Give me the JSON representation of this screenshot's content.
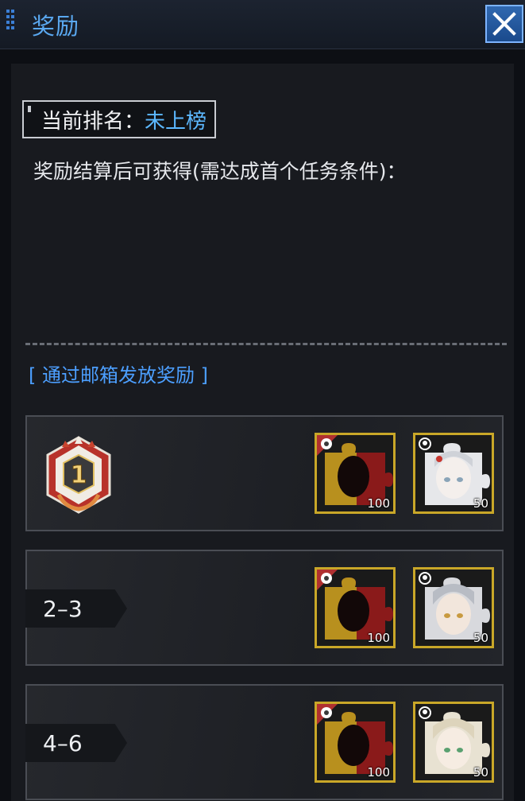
{
  "header": {
    "title": "奖励"
  },
  "rank": {
    "label": "当前排名：",
    "value": "未上榜"
  },
  "note": "奖励结算后可获得(需达成首个任务条件)：",
  "mail_note": "[ 通过邮箱发放奖励 ]",
  "rows": [
    {
      "rank_label": "1",
      "items": [
        {
          "icon": "puzzle-red-gold-icon",
          "quantity": "100"
        },
        {
          "icon": "puzzle-character-white-hair-icon",
          "quantity": "50"
        }
      ]
    },
    {
      "rank_label": "2–3",
      "items": [
        {
          "icon": "puzzle-red-gold-icon",
          "quantity": "100"
        },
        {
          "icon": "puzzle-character-silver-hair-icon",
          "quantity": "50"
        }
      ]
    },
    {
      "rank_label": "4–6",
      "items": [
        {
          "icon": "puzzle-red-gold-icon",
          "quantity": "100"
        },
        {
          "icon": "puzzle-character-blonde-hair-icon",
          "quantity": "50"
        }
      ]
    }
  ],
  "colors": {
    "accent_blue": "#5cb8ff",
    "item_border_gold": "#c9a728",
    "medal_red": "#b8322a"
  }
}
